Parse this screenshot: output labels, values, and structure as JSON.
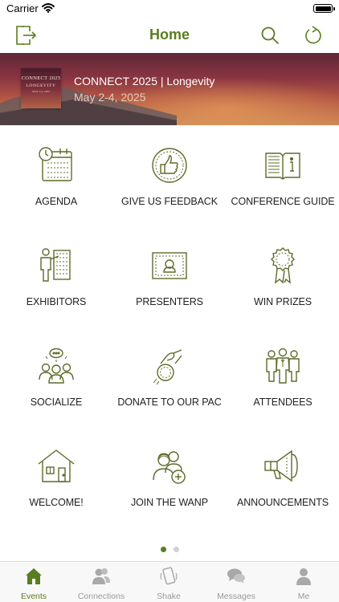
{
  "status_bar": {
    "carrier": "Carrier"
  },
  "nav": {
    "title": "Home"
  },
  "banner": {
    "thumb_title": "CONNECT 2025",
    "thumb_subtitle": "LONGEVITY",
    "thumb_date": "MAY 2-4, 2025",
    "event_title": "CONNECT 2025 | Longevity",
    "event_date": "May 2-4, 2025"
  },
  "grid": {
    "items": [
      {
        "label": "AGENDA",
        "icon": "calendar-clock-icon"
      },
      {
        "label": "GIVE US FEEDBACK",
        "icon": "thumbs-up-icon"
      },
      {
        "label": "CONFERENCE GUIDE",
        "icon": "info-book-icon"
      },
      {
        "label": "EXHIBITORS",
        "icon": "presenter-board-icon"
      },
      {
        "label": "PRESENTERS",
        "icon": "presenter-portrait-icon"
      },
      {
        "label": "WIN PRIZES",
        "icon": "award-ribbon-icon"
      },
      {
        "label": "SOCIALIZE",
        "icon": "people-chat-icon"
      },
      {
        "label": "DONATE TO OUR PAC",
        "icon": "donate-coin-icon"
      },
      {
        "label": "ATTENDEES",
        "icon": "attendees-group-icon"
      },
      {
        "label": "WELCOME!",
        "icon": "house-icon"
      },
      {
        "label": "JOIN THE WANP",
        "icon": "join-group-icon"
      },
      {
        "label": "ANNOUNCEMENTS",
        "icon": "megaphone-icon"
      }
    ]
  },
  "pagination": {
    "pages": 2,
    "current": 1
  },
  "tabs": [
    {
      "label": "Events",
      "icon": "home-icon",
      "active": true
    },
    {
      "label": "Connections",
      "icon": "connections-icon",
      "active": false
    },
    {
      "label": "Shake",
      "icon": "shake-phone-icon",
      "active": false
    },
    {
      "label": "Messages",
      "icon": "messages-icon",
      "active": false
    },
    {
      "label": "Me",
      "icon": "person-icon",
      "active": false
    }
  ],
  "colors": {
    "accent": "#5a7d1f",
    "inactive": "#9a9a9a",
    "icon_stroke": "#5d6b2a"
  }
}
